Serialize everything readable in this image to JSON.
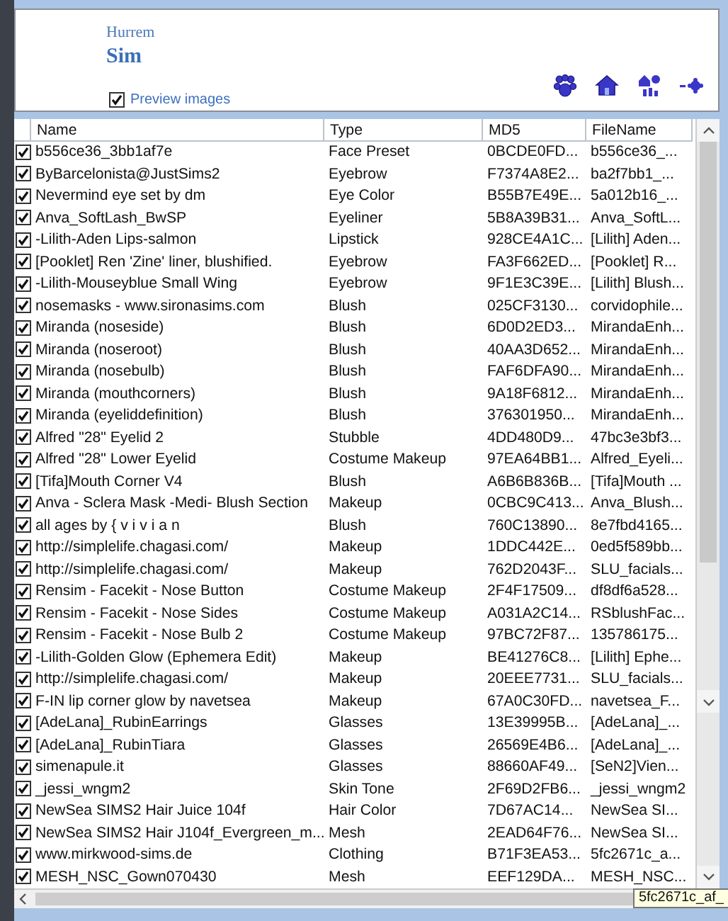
{
  "header": {
    "subtitle": "Hurrem",
    "title": "Sim",
    "preview_images": {
      "label": "Preview images",
      "checked": true
    }
  },
  "table": {
    "columns": [
      "Name",
      "Type",
      "MD5",
      "FileName"
    ],
    "rows": [
      {
        "checked": true,
        "name": "b556ce36_3bb1af7e",
        "type": "Face Preset",
        "md5": "0BCDE0FD...",
        "file": "b556ce36_..."
      },
      {
        "checked": true,
        "name": "ByBarcelonista@JustSims2",
        "type": "Eyebrow",
        "md5": "F7374A8E2...",
        "file": "ba2f7bb1_..."
      },
      {
        "checked": true,
        "name": "Nevermind eye set by dm",
        "type": "Eye Color",
        "md5": "B55B7E49E...",
        "file": "5a012b16_..."
      },
      {
        "checked": true,
        "name": "Anva_SoftLash_BwSP",
        "type": "Eyeliner",
        "md5": "5B8A39B31...",
        "file": "Anva_SoftL..."
      },
      {
        "checked": true,
        "name": "-Lilith-Aden Lips-salmon",
        "type": "Lipstick",
        "md5": "928CE4A1C...",
        "file": "[Lilith] Aden..."
      },
      {
        "checked": true,
        "name": "[Pooklet] Ren 'Zine' liner, blushified.",
        "type": "Eyebrow",
        "md5": "FA3F662ED...",
        "file": "[Pooklet] R..."
      },
      {
        "checked": true,
        "name": "-Lilith-Mouseyblue Small Wing",
        "type": "Eyebrow",
        "md5": "9F1E3C39E...",
        "file": "[Lilith] Blush..."
      },
      {
        "checked": true,
        "name": "nosemasks - www.sironasims.com",
        "type": "Blush",
        "md5": "025CF3130...",
        "file": "corvidophile..."
      },
      {
        "checked": true,
        "name": "Miranda (noseside)",
        "type": "Blush",
        "md5": "6D0D2ED3...",
        "file": "MirandaEnh..."
      },
      {
        "checked": true,
        "name": "Miranda (noseroot)",
        "type": "Blush",
        "md5": "40AA3D652...",
        "file": "MirandaEnh..."
      },
      {
        "checked": true,
        "name": "Miranda (nosebulb)",
        "type": "Blush",
        "md5": "FAF6DFA90...",
        "file": "MirandaEnh..."
      },
      {
        "checked": true,
        "name": "Miranda (mouthcorners)",
        "type": "Blush",
        "md5": "9A18F6812...",
        "file": "MirandaEnh..."
      },
      {
        "checked": true,
        "name": "Miranda (eyeliddefinition)",
        "type": "Blush",
        "md5": "376301950...",
        "file": "MirandaEnh..."
      },
      {
        "checked": true,
        "name": "Alfred \"28\" Eyelid 2",
        "type": "Stubble",
        "md5": "4DD480D9...",
        "file": "47bc3e3bf3..."
      },
      {
        "checked": true,
        "name": "Alfred \"28\" Lower Eyelid",
        "type": "Costume Makeup",
        "md5": "97EA64BB1...",
        "file": "Alfred_Eyeli..."
      },
      {
        "checked": true,
        "name": "[Tifa]Mouth Corner V4",
        "type": "Blush",
        "md5": "A6B6B836B...",
        "file": "[Tifa]Mouth ..."
      },
      {
        "checked": true,
        "name": "Anva - Sclera Mask -Medi- Blush Section",
        "type": "Makeup",
        "md5": "0CBC9C413...",
        "file": "Anva_Blush..."
      },
      {
        "checked": true,
        "name": "all ages by { v i v i a n",
        "type": "Blush",
        "md5": "760C13890...",
        "file": "8e7fbd4165..."
      },
      {
        "checked": true,
        "name": "http://simplelife.chagasi.com/",
        "type": "Makeup",
        "md5": "1DDC442E...",
        "file": "0ed5f589bb..."
      },
      {
        "checked": true,
        "name": "http://simplelife.chagasi.com/",
        "type": "Makeup",
        "md5": "762D2043F...",
        "file": "SLU_facials..."
      },
      {
        "checked": true,
        "name": "Rensim - Facekit - Nose Button",
        "type": "Costume Makeup",
        "md5": "2F4F17509...",
        "file": "df8df6a528..."
      },
      {
        "checked": true,
        "name": "Rensim - Facekit - Nose Sides",
        "type": "Costume Makeup",
        "md5": "A031A2C14...",
        "file": "RSblushFac..."
      },
      {
        "checked": true,
        "name": "Rensim - Facekit - Nose Bulb 2",
        "type": "Costume Makeup",
        "md5": "97BC72F87...",
        "file": "135786175..."
      },
      {
        "checked": true,
        "name": "-Lilith-Golden Glow (Ephemera Edit)",
        "type": "Makeup",
        "md5": "BE41276C8...",
        "file": "[Lilith] Ephe..."
      },
      {
        "checked": true,
        "name": "http://simplelife.chagasi.com/",
        "type": "Makeup",
        "md5": "20EEE7731...",
        "file": "SLU_facials..."
      },
      {
        "checked": true,
        "name": "F-IN lip corner glow by navetsea",
        "type": "Makeup",
        "md5": "67A0C30FD...",
        "file": "navetsea_F..."
      },
      {
        "checked": true,
        "name": "[AdeLana]_RubinEarrings",
        "type": "Glasses",
        "md5": "13E39995B...",
        "file": "[AdeLana]_..."
      },
      {
        "checked": true,
        "name": "[AdeLana]_RubinTiara",
        "type": "Glasses",
        "md5": "26569E4B6...",
        "file": "[AdeLana]_..."
      },
      {
        "checked": true,
        "name": "simenapule.it",
        "type": "Glasses",
        "md5": "88660AF49...",
        "file": "[SeN2]Vien..."
      },
      {
        "checked": true,
        "name": "_jessi_wngm2",
        "type": "Skin Tone",
        "md5": "2F69D2FB6...",
        "file": "_jessi_wngm2"
      },
      {
        "checked": true,
        "name": "NewSea SIMS2 Hair Juice 104f",
        "type": "Hair Color",
        "md5": "7D67AC14...",
        "file": "NewSea SI..."
      },
      {
        "checked": true,
        "name": "NewSea SIMS2 Hair J104f_Evergreen_m...",
        "type": "Mesh",
        "md5": "2EAD64F76...",
        "file": "NewSea SI..."
      },
      {
        "checked": true,
        "name": "www.mirkwood-sims.de",
        "type": "Clothing",
        "md5": "B71F3EA53...",
        "file": "5fc2671c_a..."
      },
      {
        "checked": true,
        "name": "MESH_NSC_Gown070430",
        "type": "Mesh",
        "md5": "EEF129DA...",
        "file": "MESH_NSC..."
      }
    ],
    "tooltip": "5fc2671c_af_"
  }
}
